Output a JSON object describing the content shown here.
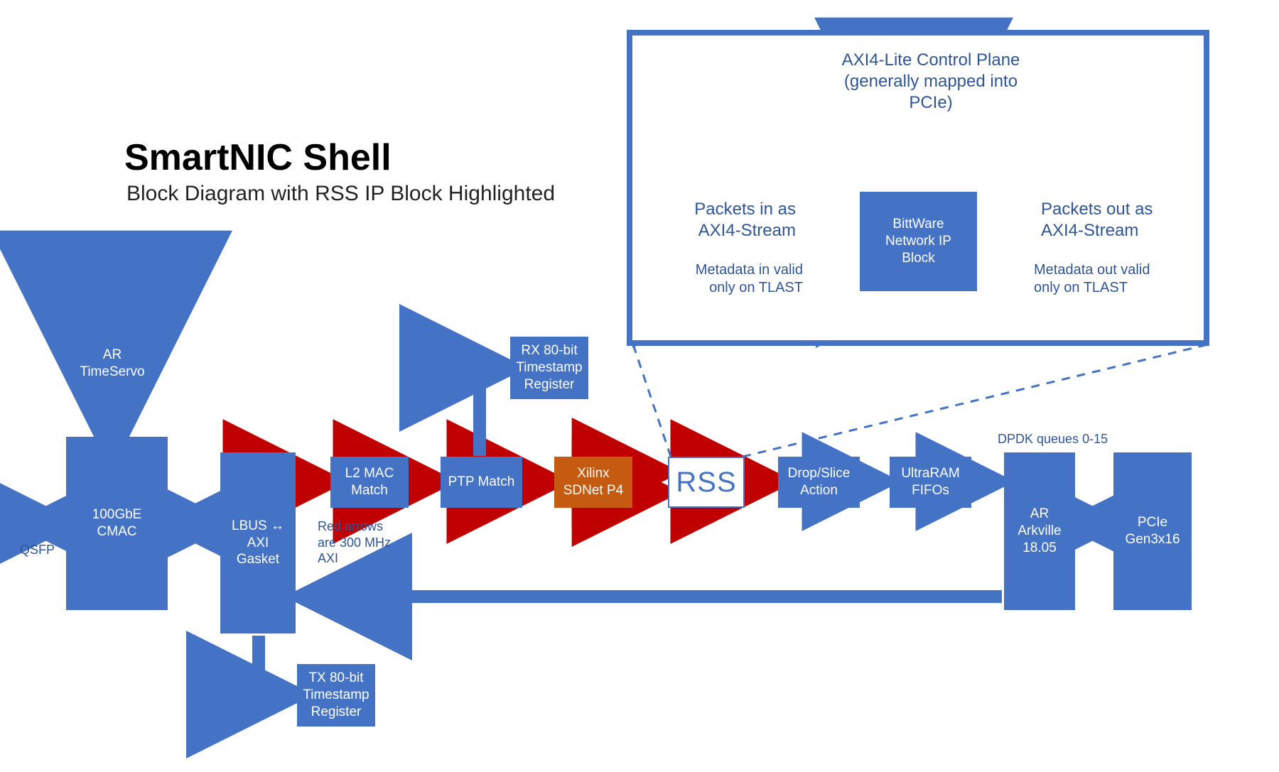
{
  "title": {
    "main": "SmartNIC Shell",
    "sub": "Block Diagram with RSS IP Block Highlighted"
  },
  "boxes": {
    "ar_timeservo": "AR\nTimeServo",
    "cmac": "100GbE\nCMAC",
    "lbus": "LBUS ↔\nAXI\nGasket",
    "l2mac": "L2 MAC\nMatch",
    "ptp": "PTP Match",
    "sdnet": "Xilinx\nSDNet P4",
    "rss": "RSS",
    "dropslice": "Drop/Slice\nAction",
    "ultraram": "UltraRAM\nFIFOs",
    "arkville": "AR\nArkville\n18.05",
    "pcie": "PCIe\nGen3x16",
    "rx_ts": "RX 80-bit\nTimestamp\nRegister",
    "tx_ts": "TX 80-bit\nTimestamp\nRegister"
  },
  "labels": {
    "qsfp": "QSFP",
    "red_note": "Red arrows\nare 300 MHz\nAXI",
    "dpdk": "DPDK queues 0-15"
  },
  "inset": {
    "control_plane": "AXI4-Lite Control Plane\n(generally mapped into\nPCIe)",
    "packets_in": "Packets in as\nAXI4-Stream",
    "meta_in": "Metadata in valid\nonly on TLAST",
    "center": "BittWare\nNetwork IP\nBlock",
    "packets_out": "Packets out as\nAXI4-Stream",
    "meta_out": "Metadata out valid\nonly on TLAST"
  }
}
